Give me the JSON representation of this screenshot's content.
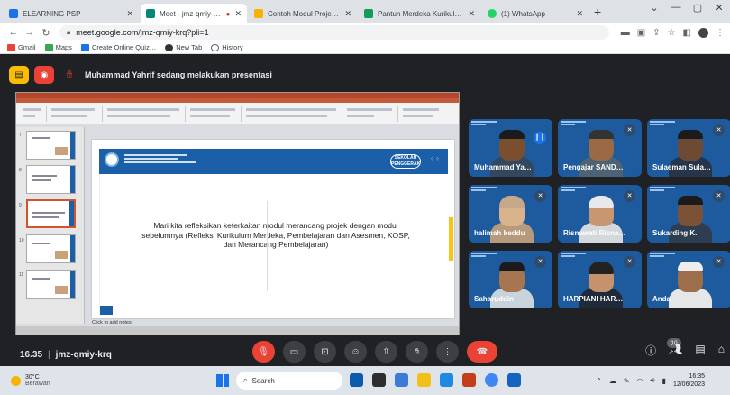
{
  "browser": {
    "tabs": [
      {
        "label": "ELEARNING PSP",
        "color": "#1a73e8",
        "active": false
      },
      {
        "label": "Meet - jmz-qmiy-krq",
        "color": "#00897b",
        "active": true
      },
      {
        "label": "Contoh Modul Projek_Ko…",
        "color": "#f4b400",
        "active": false
      },
      {
        "label": "Pantun Merdeka Kurikulu…",
        "color": "#0f9d58",
        "active": false
      },
      {
        "label": "(1) WhatsApp",
        "color": "#25d366",
        "active": false
      }
    ],
    "new_tab": "+",
    "url": "meet.google.com/jmz-qmiy-krq?pli=1",
    "bookmarks": [
      {
        "label": "Gmail",
        "color": "#ea4335"
      },
      {
        "label": "Maps",
        "color": "#34a853"
      },
      {
        "label": "Create Online Quiz…",
        "color": "#1a73e8"
      },
      {
        "label": "New Tab",
        "color": "#333333"
      },
      {
        "label": "History",
        "color": "#5f6368"
      }
    ]
  },
  "meet": {
    "presenting_text": "Muhammad Yahrif sedang melakukan presentasi",
    "meeting_time": "16.35",
    "meeting_code": "jmz-qmiy-krq",
    "participant_count": "10",
    "slide": {
      "text": "Mari kita refleksikan keterkaitan modul merancang projek dengan modul sebelumnya (Refleksi Kurikulum Merdeka, Pembelajaran dan Asesmen, KOSP, dan Merancang Pembelajaran)",
      "badge": "SEKOLAH PENGGERAK",
      "notes": "Click to add notes"
    },
    "participants": [
      {
        "name": "Muhammad Ya…",
        "speaking": true
      },
      {
        "name": "Pengajar SAND…",
        "speaking": false
      },
      {
        "name": "Sulaeman Sula…",
        "speaking": false
      },
      {
        "name": "halimah beddu",
        "speaking": false
      },
      {
        "name": "Risnawati Risna…",
        "speaking": false
      },
      {
        "name": "Sukarding K.",
        "speaking": false
      },
      {
        "name": "Saharuddin",
        "speaking": false
      },
      {
        "name": "HARPIANI HAR…",
        "speaking": false
      },
      {
        "name": "Anda",
        "speaking": false
      }
    ]
  },
  "taskbar": {
    "weather_temp": "30°C",
    "weather_desc": "Berawan",
    "search_placeholder": "Search",
    "time": "16:35",
    "date": "12/06/2023"
  }
}
